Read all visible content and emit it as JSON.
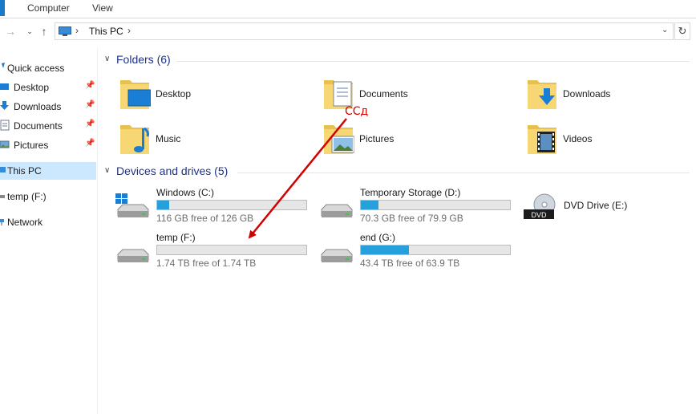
{
  "ribbon": {
    "tabs": [
      "Computer",
      "View"
    ]
  },
  "address_bar": {
    "crumb": "This PC",
    "separator": "›"
  },
  "sidebar": {
    "items": [
      {
        "label": "Quick access",
        "icon": "star-icon",
        "pinned": false
      },
      {
        "label": "Desktop",
        "icon": "desktop-icon",
        "pinned": true
      },
      {
        "label": "Downloads",
        "icon": "download-icon",
        "pinned": true
      },
      {
        "label": "Documents",
        "icon": "documents-icon",
        "pinned": true
      },
      {
        "label": "Pictures",
        "icon": "pictures-icon",
        "pinned": true
      },
      {
        "label": "This PC",
        "icon": "computer-icon",
        "pinned": false,
        "selected": true
      },
      {
        "label": "temp (F:)",
        "icon": "drive-icon",
        "pinned": false
      },
      {
        "label": "Network",
        "icon": "network-icon",
        "pinned": false
      }
    ]
  },
  "folders_group": {
    "title": "Folders (6)"
  },
  "folders": [
    {
      "name": "Desktop",
      "icon": "desktop-folder-icon"
    },
    {
      "name": "Documents",
      "icon": "documents-folder-icon"
    },
    {
      "name": "Downloads",
      "icon": "downloads-folder-icon"
    },
    {
      "name": "Music",
      "icon": "music-folder-icon"
    },
    {
      "name": "Pictures",
      "icon": "pictures-folder-icon"
    },
    {
      "name": "Videos",
      "icon": "videos-folder-icon"
    }
  ],
  "drives_group": {
    "title": "Devices and drives (5)"
  },
  "drives": [
    {
      "name": "Windows (C:)",
      "free": "116 GB free of 126 GB",
      "used_fraction": 0.08,
      "icon": "windows-drive-icon"
    },
    {
      "name": "Temporary Storage (D:)",
      "free": "70.3 GB free of 79.9 GB",
      "used_fraction": 0.12,
      "icon": "drive-icon"
    },
    {
      "name": "DVD Drive (E:)",
      "free": "",
      "used_fraction": null,
      "icon": "dvd-drive-icon",
      "badge": "DVD"
    },
    {
      "name": "temp (F:)",
      "free": "1.74 TB free of 1.74 TB",
      "used_fraction": 0.0,
      "icon": "drive-icon"
    },
    {
      "name": "end (G:)",
      "free": "43.4 TB free of 63.9 TB",
      "used_fraction": 0.32,
      "icon": "drive-icon"
    }
  ],
  "annotation": {
    "text": "ССд",
    "color": "#d40000"
  },
  "colors": {
    "accent": "#1979ca",
    "selected_bg": "#cce8ff",
    "bar_fill": "#26a0da",
    "header_text": "#1e3287"
  }
}
